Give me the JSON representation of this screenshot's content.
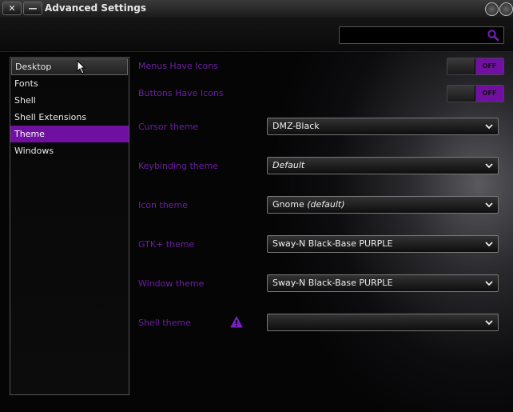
{
  "window": {
    "title": "Advanced Settings",
    "close_glyph": "✕",
    "minimize_glyph": "—"
  },
  "toolbar": {
    "search_placeholder": "",
    "search_icon": "search-icon"
  },
  "sidebar": {
    "items": [
      {
        "label": "Desktop",
        "state": "hover"
      },
      {
        "label": "Fonts",
        "state": ""
      },
      {
        "label": "Shell",
        "state": ""
      },
      {
        "label": "Shell Extensions",
        "state": ""
      },
      {
        "label": "Theme",
        "state": "selected"
      },
      {
        "label": "Windows",
        "state": ""
      }
    ]
  },
  "settings": {
    "menus_have_icons": {
      "label": "Menus Have Icons",
      "toggle": "OFF"
    },
    "buttons_have_icons": {
      "label": "Buttons Have Icons",
      "toggle": "OFF"
    },
    "cursor_theme": {
      "label": "Cursor theme",
      "value": "DMZ-Black",
      "suffix": ""
    },
    "keybinding_theme": {
      "label": "Keybinding theme",
      "value": "",
      "suffix": "Default"
    },
    "icon_theme": {
      "label": "Icon theme",
      "value": "Gnome ",
      "suffix": "(default)"
    },
    "gtk_theme": {
      "label": "GTK+ theme",
      "value": "Sway-N Black-Base PURPLE",
      "suffix": ""
    },
    "window_theme": {
      "label": "Window theme",
      "value": "Sway-N Black-Base PURPLE",
      "suffix": ""
    },
    "shell_theme": {
      "label": "Shell theme",
      "value": "",
      "suffix": "",
      "warning_icon": "warning-icon"
    }
  },
  "colors": {
    "accent": "#6f10a0",
    "label": "#6b1ea0"
  }
}
